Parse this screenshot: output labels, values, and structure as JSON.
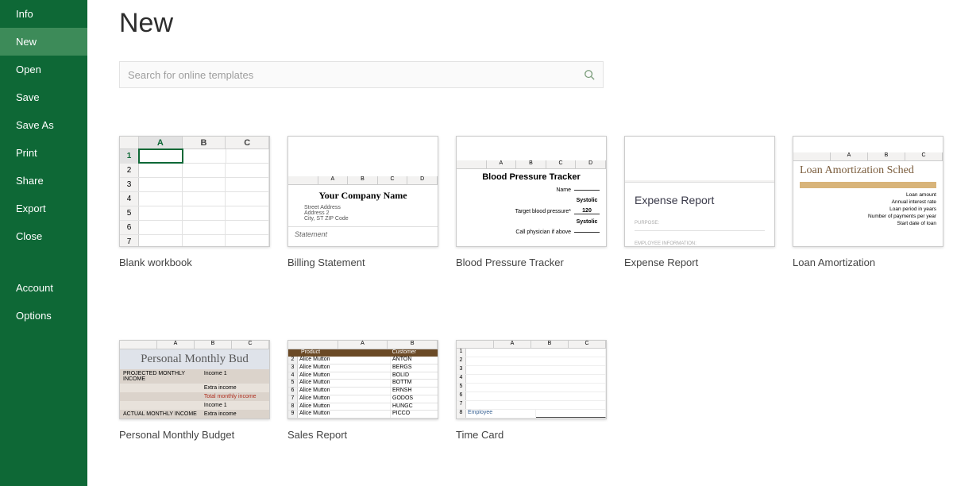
{
  "sidebar": {
    "items": [
      {
        "label": "Info"
      },
      {
        "label": "New"
      },
      {
        "label": "Open"
      },
      {
        "label": "Save"
      },
      {
        "label": "Save As"
      },
      {
        "label": "Print"
      },
      {
        "label": "Share"
      },
      {
        "label": "Export"
      },
      {
        "label": "Close"
      }
    ],
    "bottom": [
      {
        "label": "Account"
      },
      {
        "label": "Options"
      }
    ],
    "active_index": 1
  },
  "main": {
    "title": "New",
    "search_placeholder": "Search for online templates"
  },
  "templates_row1": [
    {
      "label": "Blank workbook"
    },
    {
      "label": "Billing Statement"
    },
    {
      "label": "Blood Pressure Tracker"
    },
    {
      "label": "Expense Report"
    },
    {
      "label": "Loan Amortization"
    }
  ],
  "templates_row2": [
    {
      "label": "Personal Monthly Budget"
    },
    {
      "label": "Sales Report"
    },
    {
      "label": "Time Card"
    }
  ],
  "thumbs": {
    "blank": {
      "cols": [
        "A",
        "B",
        "C"
      ],
      "rows": [
        1,
        2,
        3,
        4,
        5,
        6,
        7
      ]
    },
    "billing": {
      "cols": [
        "A",
        "B",
        "C",
        "D"
      ],
      "company": "Your Company Name",
      "lines": [
        "Street Address",
        "Address 2",
        "City, ST  ZIP Code"
      ],
      "footer": "Statement"
    },
    "bp": {
      "cols": [
        "A",
        "B",
        "C",
        "D"
      ],
      "title": "Blood Pressure Tracker",
      "fields": [
        {
          "lbl": "Name",
          "val": ""
        },
        {
          "lbl": "",
          "val": "Systolic"
        },
        {
          "lbl": "Target blood pressure*",
          "val": "120"
        },
        {
          "lbl": "",
          "val": "Systolic"
        },
        {
          "lbl": "Call physician if above",
          "val": ""
        }
      ]
    },
    "expense": {
      "title": "Expense Report",
      "sub1": "PURPOSE:",
      "sub2": "EMPLOYEE INFORMATION:"
    },
    "loan": {
      "cols": [
        "A",
        "B",
        "C"
      ],
      "title": "Loan Amortization Sched",
      "labels": [
        "Loan amount",
        "Annual interest rate",
        "Loan period in years",
        "Number of payments per year",
        "Start date of loan"
      ]
    },
    "pmb": {
      "cols": [
        "A",
        "B",
        "C"
      ],
      "title": "Personal Monthly Bud",
      "rows": [
        {
          "l": "PROJECTED MONTHLY INCOME",
          "r": "Income 1"
        },
        {
          "l": "",
          "r": "Extra income"
        },
        {
          "l": "",
          "r": "Total monthly income"
        },
        {
          "l": "",
          "r": "Income 1"
        },
        {
          "l": "ACTUAL MONTHLY INCOME",
          "r": "Extra income"
        }
      ]
    },
    "sales": {
      "cols": [
        "A",
        "B"
      ],
      "header": {
        "c1": "Product",
        "c2": "Customer"
      },
      "rows": [
        {
          "n": "2",
          "p": "Alice Mutton",
          "c": "ANTON"
        },
        {
          "n": "3",
          "p": "Alice Mutton",
          "c": "BERGS"
        },
        {
          "n": "4",
          "p": "Alice Mutton",
          "c": "BOLID"
        },
        {
          "n": "5",
          "p": "Alice Mutton",
          "c": "BOTTM"
        },
        {
          "n": "6",
          "p": "Alice Mutton",
          "c": "ERNSH"
        },
        {
          "n": "7",
          "p": "Alice Mutton",
          "c": "GODOS"
        },
        {
          "n": "8",
          "p": "Alice Mutton",
          "c": "HUNGC"
        },
        {
          "n": "9",
          "p": "Alice Mutton",
          "c": "PICCO"
        }
      ]
    },
    "timecard": {
      "cols": [
        "A",
        "B",
        "C"
      ],
      "rownums": [
        "1",
        "2",
        "3",
        "4",
        "5",
        "6",
        "7",
        "8"
      ],
      "label": "Employee"
    }
  }
}
